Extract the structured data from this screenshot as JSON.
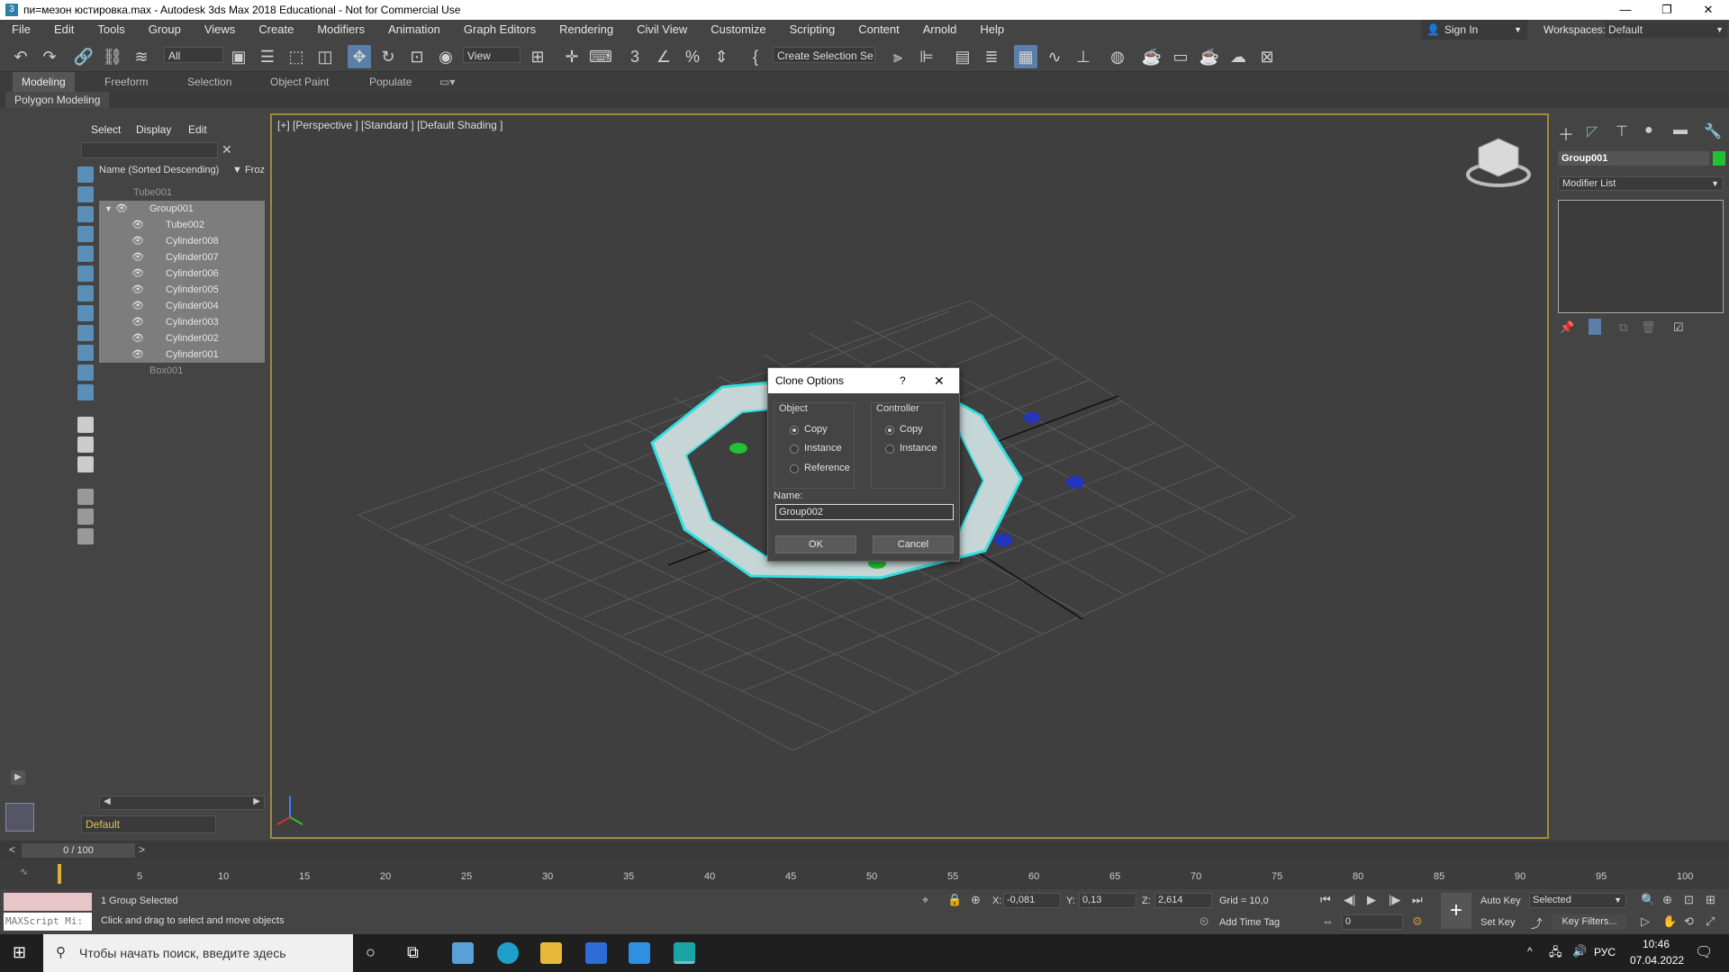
{
  "window": {
    "title": "пи=мезон юстировка.max - Autodesk 3ds Max 2018 Educational - Not for Commercial Use",
    "app_icon": "3ds-max-icon"
  },
  "menu": [
    "File",
    "Edit",
    "Tools",
    "Group",
    "Views",
    "Create",
    "Modifiers",
    "Animation",
    "Graph Editors",
    "Rendering",
    "Civil View",
    "Customize",
    "Scripting",
    "Content",
    "Arnold",
    "Help"
  ],
  "account": {
    "sign_in": "Sign In",
    "workspaces_label": "Workspaces:",
    "workspace_value": "Default"
  },
  "toolbar": {
    "filter_value": "All",
    "reference_value": "View",
    "selection_set": "Create Selection Se"
  },
  "ribbon": {
    "tabs": [
      "Modeling",
      "Freeform",
      "Selection",
      "Object Paint",
      "Populate"
    ],
    "sub": "Polygon Modeling"
  },
  "explorer": {
    "tabs": [
      "Select",
      "Display",
      "Edit"
    ],
    "header_name": "Name (Sorted Descending)",
    "header_frozen": "Froz",
    "items": [
      {
        "label": "Tube001"
      },
      {
        "label": "Group001"
      },
      {
        "label": "Tube002"
      },
      {
        "label": "Cylinder008"
      },
      {
        "label": "Cylinder007"
      },
      {
        "label": "Cylinder006"
      },
      {
        "label": "Cylinder005"
      },
      {
        "label": "Cylinder004"
      },
      {
        "label": "Cylinder003"
      },
      {
        "label": "Cylinder002"
      },
      {
        "label": "Cylinder001"
      },
      {
        "label": "Box001"
      }
    ],
    "layer": "Default"
  },
  "viewport": {
    "label": "[+] [Perspective ] [Standard ] [Default Shading ]"
  },
  "right_panel": {
    "object_name": "Group001",
    "modifier_list": "Modifier List",
    "object_color": "#22c033"
  },
  "dialog": {
    "title": "Clone Options",
    "help": "?",
    "object_group": "Object",
    "object_options": [
      "Copy",
      "Instance",
      "Reference"
    ],
    "controller_group": "Controller",
    "controller_options": [
      "Copy",
      "Instance"
    ],
    "name_label": "Name:",
    "name_value": "Group002",
    "ok": "OK",
    "cancel": "Cancel"
  },
  "timeline": {
    "frame": "0 / 100",
    "ticks": [
      "5",
      "10",
      "15",
      "20",
      "25",
      "30",
      "35",
      "40",
      "45",
      "50",
      "55",
      "60",
      "65",
      "70",
      "75",
      "80",
      "85",
      "90",
      "95",
      "100"
    ]
  },
  "status": {
    "maxscript": "MAXScript Mi:",
    "selected": "1 Group Selected",
    "hint": "Click and drag to select and move objects",
    "x_label": "X:",
    "x": "-0,081",
    "y_label": "Y:",
    "y": "0,13",
    "z_label": "Z:",
    "z": "2,614",
    "grid": "Grid = 10,0",
    "add_time_tag": "Add Time Tag",
    "auto_key": "Auto Key",
    "key_mode": "Selected",
    "set_key": "Set Key",
    "key_filters": "Key Filters...",
    "frame_value": "0"
  },
  "taskbar": {
    "search": "Чтобы начать поиск, введите здесь",
    "lang": "РУС",
    "time": "10:46",
    "date": "07.04.2022"
  }
}
